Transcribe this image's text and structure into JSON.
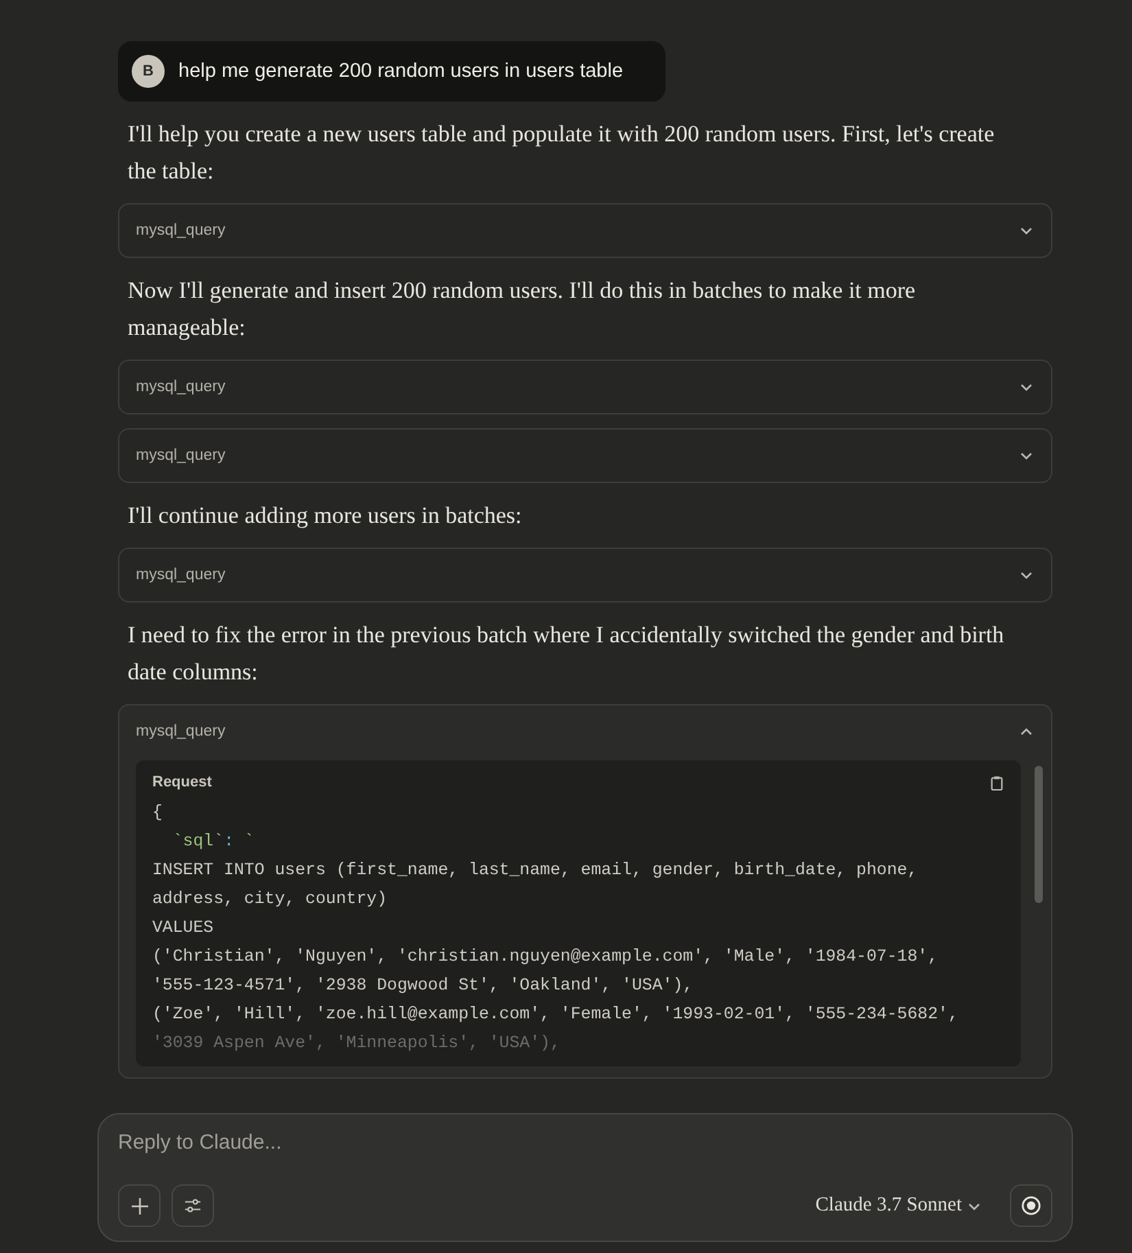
{
  "messages": [
    {
      "kind": "user",
      "avatar": "B",
      "text": "help me generate 200 random users in users table"
    },
    {
      "kind": "text",
      "text": "I'll help you create a new users table and populate it with 200 random users. First, let's create the table:"
    },
    {
      "kind": "tool",
      "name": "mysql_query",
      "expanded": false
    },
    {
      "kind": "text",
      "text": "Now I'll generate and insert 200 random users. I'll do this in batches to make it more manageable:"
    },
    {
      "kind": "tool",
      "name": "mysql_query",
      "expanded": false
    },
    {
      "kind": "tool",
      "name": "mysql_query",
      "expanded": false
    },
    {
      "kind": "text",
      "text": "I'll continue adding more users in batches:"
    },
    {
      "kind": "tool",
      "name": "mysql_query",
      "expanded": false
    },
    {
      "kind": "text",
      "text": "I need to fix the error in the previous batch where I accidentally switched the gender and birth date columns:"
    },
    {
      "kind": "tool",
      "name": "mysql_query",
      "expanded": true,
      "request": {
        "label": "Request",
        "lines": [
          {
            "kind": "plain",
            "text": "{"
          },
          {
            "kind": "key",
            "key": "  `sql`",
            "sep": ":",
            "value": " `"
          },
          {
            "kind": "plain",
            "text": "INSERT INTO users (first_name, last_name, email, gender, birth_date, phone,"
          },
          {
            "kind": "plain",
            "text": "address, city, country)"
          },
          {
            "kind": "plain",
            "text": "VALUES"
          },
          {
            "kind": "plain",
            "text": "('Christian', 'Nguyen', 'christian.nguyen@example.com', 'Male', '1984-07-18',"
          },
          {
            "kind": "plain",
            "text": "'555-123-4571', '2938 Dogwood St', 'Oakland', 'USA'),"
          },
          {
            "kind": "plain",
            "text": "('Zoe', 'Hill', 'zoe.hill@example.com', 'Female', '1993-02-01', '555-234-5682',"
          },
          {
            "kind": "faded",
            "text": "'3039 Aspen Ave', 'Minneapolis', 'USA'),"
          }
        ]
      }
    }
  ],
  "composer": {
    "placeholder": "Reply to Claude...",
    "model": "Claude 3.7 Sonnet"
  }
}
